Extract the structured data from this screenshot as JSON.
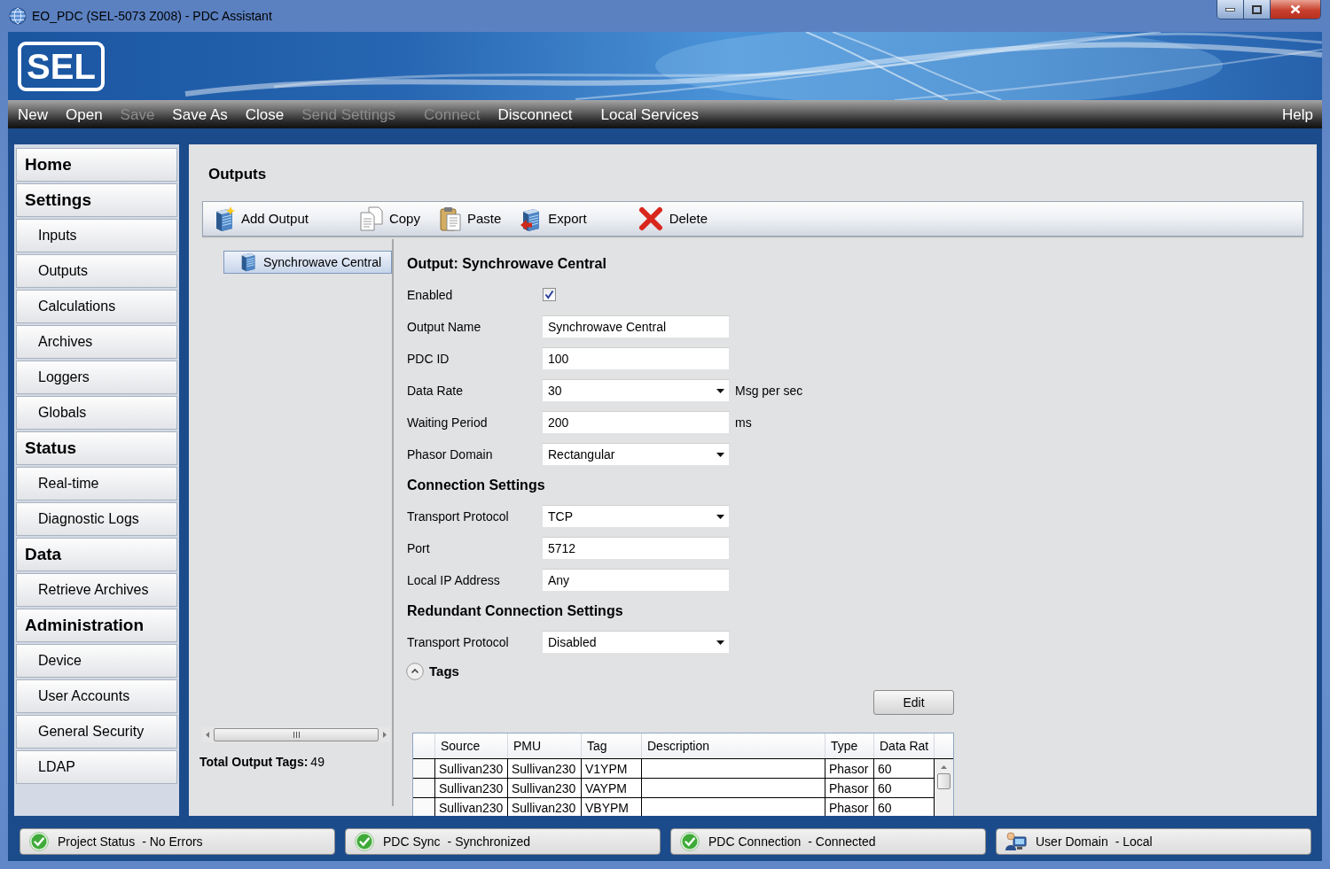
{
  "window": {
    "title": "EO_PDC (SEL-5073 Z008) - PDC Assistant"
  },
  "header": {
    "logo_text": "SEL"
  },
  "menu": {
    "groups": [
      {
        "items": [
          {
            "label": "New",
            "disabled": false
          },
          {
            "label": "Open",
            "disabled": false
          },
          {
            "label": "Save",
            "disabled": true
          },
          {
            "label": "Save As",
            "disabled": false
          },
          {
            "label": "Close",
            "disabled": false
          },
          {
            "label": "Send Settings",
            "disabled": true
          }
        ]
      },
      {
        "items": [
          {
            "label": "Connect",
            "disabled": true
          },
          {
            "label": "Disconnect",
            "disabled": false
          }
        ]
      },
      {
        "items": [
          {
            "label": "Local Services",
            "disabled": false
          }
        ]
      }
    ],
    "right": [
      {
        "label": "Help",
        "disabled": false
      }
    ]
  },
  "sidebar": [
    {
      "title": "Home"
    },
    {
      "title": "Settings",
      "items": [
        "Inputs",
        "Outputs",
        "Calculations",
        "Archives",
        "Loggers",
        "Globals"
      ]
    },
    {
      "title": "Status",
      "items": [
        "Real-time",
        "Diagnostic Logs"
      ]
    },
    {
      "title": "Data",
      "items": [
        "Retrieve Archives"
      ]
    },
    {
      "title": "Administration",
      "items": [
        "Device",
        "User Accounts",
        "General Security",
        "LDAP"
      ]
    }
  ],
  "outputs_page": {
    "title": "Outputs",
    "toolbar": [
      {
        "buttons": [
          {
            "kind": "add",
            "label": "Add Output"
          }
        ]
      },
      {
        "buttons": [
          {
            "kind": "copy",
            "label": "Copy"
          },
          {
            "kind": "paste",
            "label": "Paste"
          },
          {
            "kind": "export",
            "label": "Export"
          }
        ]
      },
      {
        "buttons": [
          {
            "kind": "delete",
            "label": "Delete"
          }
        ]
      }
    ],
    "outputs_list": [
      {
        "label": "Synchrowave Central",
        "selected": true
      }
    ],
    "total_output_tags": {
      "label": "Total Output Tags:",
      "value": "49"
    },
    "form": {
      "title": "Output: Synchrowave Central",
      "fields": [
        {
          "kind": "checkbox",
          "label": "Enabled",
          "checked": true
        },
        {
          "kind": "text",
          "label": "Output Name",
          "value": "Synchrowave Central"
        },
        {
          "kind": "text",
          "label": "PDC ID",
          "value": "100"
        },
        {
          "kind": "select",
          "label": "Data Rate",
          "value": "30",
          "unit": "Msg per sec"
        },
        {
          "kind": "text",
          "label": "Waiting Period",
          "value": "200",
          "unit": "ms"
        },
        {
          "kind": "select",
          "label": "Phasor Domain",
          "value": "Rectangular"
        }
      ],
      "sections": [
        {
          "title": "Connection Settings",
          "fields": [
            {
              "kind": "select",
              "label": "Transport Protocol",
              "value": "TCP"
            },
            {
              "kind": "text",
              "label": "Port",
              "value": "5712"
            },
            {
              "kind": "text",
              "label": "Local IP Address",
              "value": "Any"
            }
          ]
        },
        {
          "title": "Redundant Connection Settings",
          "fields": [
            {
              "kind": "select",
              "label": "Transport Protocol",
              "value": "Disabled"
            }
          ]
        }
      ]
    },
    "tags": {
      "label": "Tags",
      "expanded": true,
      "edit_button": "Edit",
      "table": {
        "columns": [
          "Source",
          "PMU",
          "Tag",
          "Description",
          "Type",
          "Data Rat"
        ],
        "rows": [
          {
            "source": "Sullivan230",
            "pmu": "Sullivan230",
            "tag": "V1YPM",
            "type": "Phasor",
            "data_rate": "60"
          },
          {
            "source": "Sullivan230",
            "pmu": "Sullivan230",
            "tag": "VAYPM",
            "type": "Phasor",
            "data_rate": "60"
          },
          {
            "source": "Sullivan230",
            "pmu": "Sullivan230",
            "tag": "VBYPM",
            "type": "Phasor",
            "data_rate": "60"
          }
        ]
      }
    }
  },
  "status_bar": [
    {
      "kind": "ok",
      "label": "Project Status",
      "value": "- No Errors"
    },
    {
      "kind": "ok",
      "label": "PDC Sync",
      "value": "- Synchronized"
    },
    {
      "kind": "ok",
      "label": "PDC Connection",
      "value": "- Connected"
    },
    {
      "kind": "user",
      "label": "User Domain",
      "value": "- Local"
    }
  ]
}
